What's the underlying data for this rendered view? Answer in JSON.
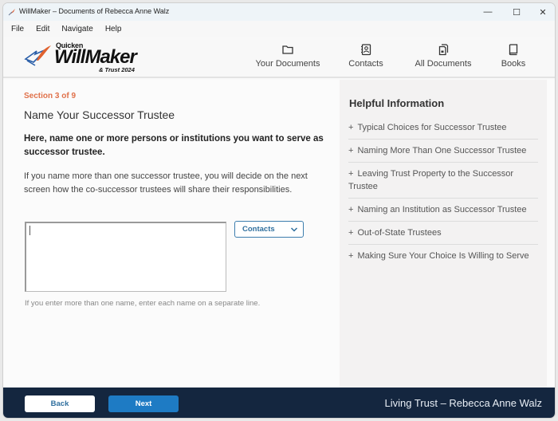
{
  "window": {
    "title": "WillMaker – Documents of Rebecca Anne Walz",
    "app_icon": "quill-icon",
    "controls": {
      "minimize": "—",
      "maximize": "☐",
      "close": "✕"
    }
  },
  "menubar": {
    "items": [
      "File",
      "Edit",
      "Navigate",
      "Help"
    ]
  },
  "header": {
    "logo": {
      "brand": "Quicken",
      "product": "WillMaker",
      "edition": "& Trust 2024"
    },
    "nav": [
      {
        "label": "Your Documents",
        "icon": "folder-icon"
      },
      {
        "label": "Contacts",
        "icon": "address-book-icon"
      },
      {
        "label": "All Documents",
        "icon": "documents-icon"
      },
      {
        "label": "Books",
        "icon": "book-icon"
      }
    ]
  },
  "main": {
    "section_label": "Section 3 of 9",
    "title": "Name Your Successor Trustee",
    "instruction": "Here, name one or more persons or institutions you want to serve as successor trustee.",
    "body": "If you name more than one successor trustee, you will decide on the next screen how the co-successor trustees will share their responsibilities.",
    "names_input": {
      "value": "",
      "placeholder": ""
    },
    "contacts_select": {
      "label": "Contacts"
    },
    "hint": "If you enter more than one name, enter each name on a separate line."
  },
  "sidebar": {
    "title": "Helpful Information",
    "items": [
      "Typical Choices for Successor Trustee",
      "Naming More Than One Successor Trustee",
      "Leaving Trust Property to the Successor Trustee",
      "Naming an Institution as Successor Trustee",
      "Out-of-State Trustees",
      "Making Sure Your Choice Is Willing to Serve"
    ],
    "item_prefix": "+"
  },
  "footer": {
    "back_label": "Back",
    "next_label": "Next",
    "document_name": "Living Trust – Rebecca Anne Walz"
  },
  "colors": {
    "accent_orange": "#e0714a",
    "primary_blue": "#1e7bc4",
    "footer_navy": "#14263f",
    "link_blue": "#2f6f9e"
  }
}
